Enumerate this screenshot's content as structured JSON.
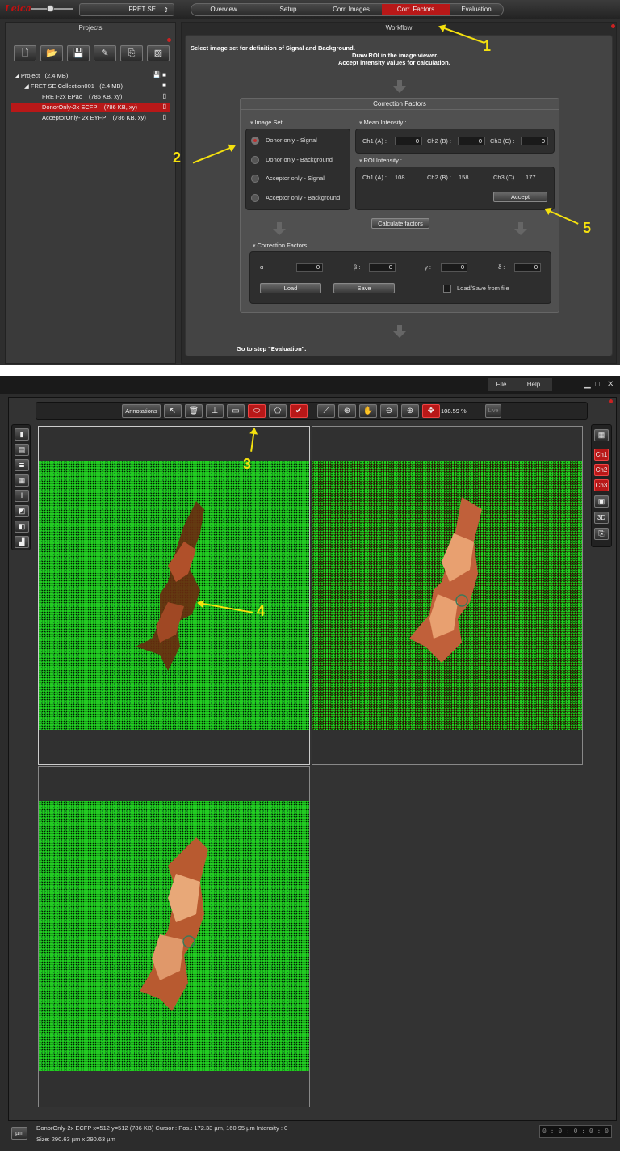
{
  "header": {
    "logo": "Leica",
    "experiment_select": "FRET SE",
    "steps": [
      "Overview",
      "Setup",
      "Corr. Images",
      "Corr. Factors",
      "Evaluation"
    ],
    "active_step": "Corr. Factors"
  },
  "projects": {
    "title": "Projects",
    "tree": [
      {
        "label": "Project",
        "size": "(2.4 MB)",
        "level": 0
      },
      {
        "label": "FRET SE Collection001",
        "size": "(2.4 MB)",
        "level": 1
      },
      {
        "label": "FRET-2x EPac",
        "size": "(786 KB, xy)",
        "level": 2
      },
      {
        "label": "DonorOnly-2x ECFP",
        "size": "(786 KB, xy)",
        "level": 2,
        "selected": true
      },
      {
        "label": "AcceptorOnly- 2x EYFP",
        "size": "(786 KB, xy)",
        "level": 2
      }
    ]
  },
  "workflow": {
    "title": "Workflow",
    "instr1": "Select image set for definition of Signal and Background.",
    "instr2": "Draw ROI in the image viewer.",
    "instr3": "Accept intensity values for calculation.",
    "goto": "Go to step \"Evaluation\"."
  },
  "corr": {
    "title": "Correction Factors",
    "image_set": {
      "title": "Image Set",
      "options": [
        "Donor only - Signal",
        "Donor only - Background",
        "Acceptor only - Signal",
        "Acceptor only - Background"
      ],
      "selected": "Donor only - Signal"
    },
    "mean": {
      "title": "Mean Intensity :",
      "ch1_label": "Ch1 (A) :",
      "ch1": "0",
      "ch2_label": "Ch2 (B) :",
      "ch2": "0",
      "ch3_label": "Ch3 (C) :",
      "ch3": "0"
    },
    "roi": {
      "title": "ROI Intensity :",
      "ch1_label": "Ch1 (A) :",
      "ch1": "108",
      "ch2_label": "Ch2 (B) :",
      "ch2": "158",
      "ch3_label": "Ch3 (C) :",
      "ch3": "177",
      "accept": "Accept"
    },
    "calc": "Calculate factors",
    "factors": {
      "title": "Correction Factors",
      "alpha_label": "α :",
      "alpha": "0",
      "beta_label": "β :",
      "beta": "0",
      "gamma_label": "γ :",
      "gamma": "0",
      "delta_label": "δ :",
      "delta": "0",
      "load": "Load",
      "save": "Save",
      "file_label": "Load/Save from file"
    }
  },
  "menu": {
    "file": "File",
    "help": "Help"
  },
  "viewer_toolbar": {
    "annotations": "Annotations",
    "zoom": "108.59 %",
    "live": "Live"
  },
  "right_side": {
    "ch1": "Ch1",
    "ch2": "Ch2",
    "ch3": "Ch3",
    "three_d": "3D"
  },
  "annotations": [
    "1",
    "2",
    "3",
    "4",
    "5"
  ],
  "status": {
    "unit": "µm",
    "line1": "DonorOnly-2x ECFP x=512 y=512  (786 KB)     Cursor :  Pos.: 172.33 µm, 160.95 µm    Intensity : 0",
    "line2": "Size: 290.63 µm x 290.63 µm",
    "timer": "0 : 0 : 0 : 0 : 0"
  },
  "colors": {
    "accent": "#b81818",
    "annotation": "#f5e10e",
    "image_green": "#22cc22"
  }
}
